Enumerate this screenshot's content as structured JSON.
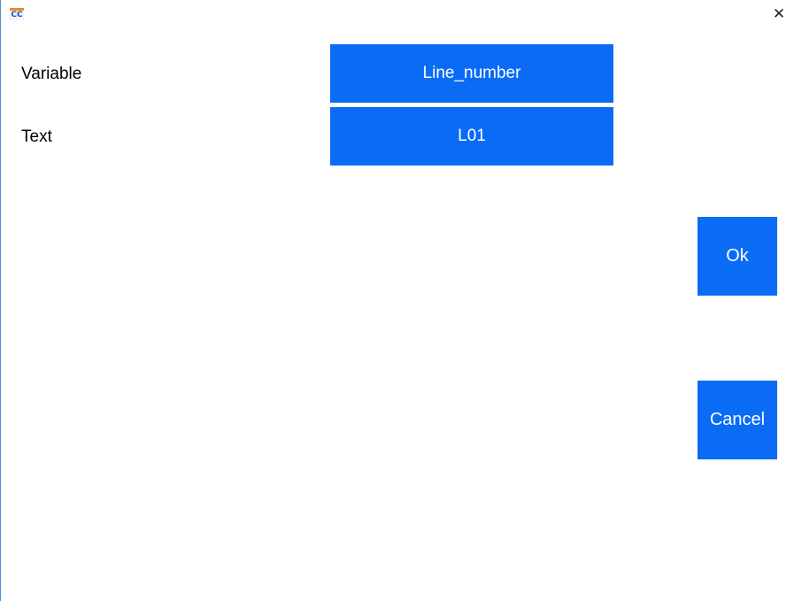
{
  "window": {
    "icon_text": "CC",
    "close_glyph": "✕"
  },
  "form": {
    "variable_label": "Variable",
    "variable_value": "Line_number",
    "text_label": "Text",
    "text_value": "L01"
  },
  "actions": {
    "ok_label": "Ok",
    "cancel_label": "Cancel"
  },
  "colors": {
    "button_blue": "#0a6cf5",
    "button_text": "#ffffff",
    "window_border": "#4a90d9"
  }
}
